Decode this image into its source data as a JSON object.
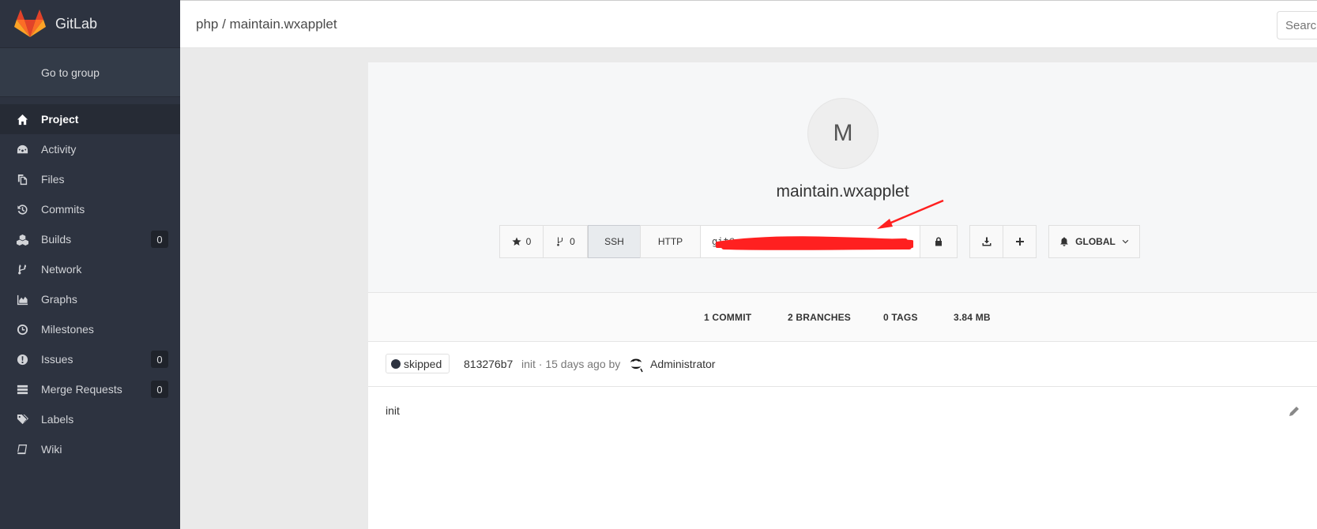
{
  "brand": {
    "name": "GitLab"
  },
  "sidebar": {
    "go_to_group": "Go to group",
    "items": [
      {
        "label": "Project",
        "icon": "home-icon",
        "active": true
      },
      {
        "label": "Activity",
        "icon": "dashboard-icon"
      },
      {
        "label": "Files",
        "icon": "files-icon"
      },
      {
        "label": "Commits",
        "icon": "history-icon"
      },
      {
        "label": "Builds",
        "icon": "cubes-icon",
        "badge": "0"
      },
      {
        "label": "Network",
        "icon": "code-fork-icon"
      },
      {
        "label": "Graphs",
        "icon": "area-chart-icon"
      },
      {
        "label": "Milestones",
        "icon": "clock-icon"
      },
      {
        "label": "Issues",
        "icon": "exclamation-circle-icon",
        "badge": "0"
      },
      {
        "label": "Merge Requests",
        "icon": "tasks-icon",
        "badge": "0"
      },
      {
        "label": "Labels",
        "icon": "tags-icon"
      },
      {
        "label": "Wiki",
        "icon": "book-icon"
      }
    ]
  },
  "header": {
    "breadcrumb": "php / maintain.wxapplet",
    "search_placeholder": "Search"
  },
  "project": {
    "avatar_letter": "M",
    "title": "maintain.wxapplet",
    "star_count": "0",
    "fork_count": "0",
    "ssh_label": "SSH",
    "http_label": "HTTP",
    "clone_url": "git@                  wxapplet.git",
    "notification_label": "GLOBAL"
  },
  "stats": {
    "commits": "1 COMMIT",
    "branches": "2 BRANCHES",
    "tags": "0 TAGS",
    "size": "3.84 MB"
  },
  "last_commit": {
    "status": "skipped",
    "sha": "813276b7",
    "meta": "init · 15 days ago by",
    "author": "Administrator"
  },
  "readme": {
    "text": "init"
  },
  "colors": {
    "sidebar_bg": "#2d3340",
    "scribble": "#ff2020",
    "logo_orange": "#e24329"
  }
}
